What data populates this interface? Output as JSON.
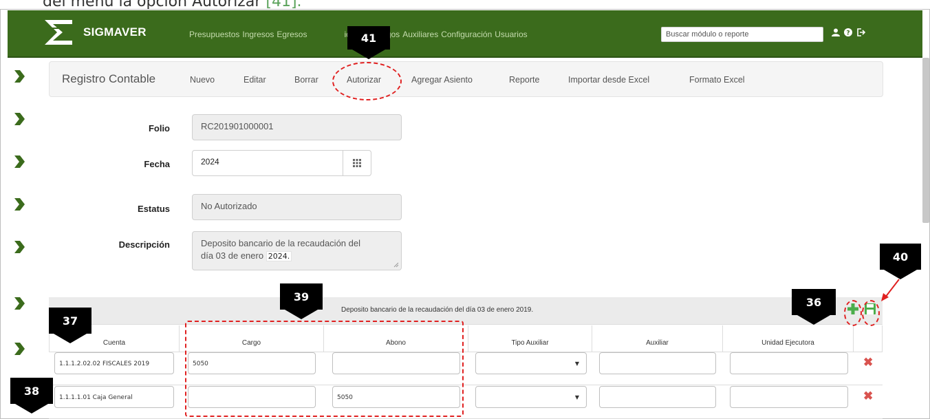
{
  "doc_caption": {
    "text": "del menú la opción Autorizar",
    "ref": "[41]."
  },
  "app": {
    "brand": "SIGMAVER"
  },
  "nav": {
    "items": [
      "Presupuestos",
      "Ingresos",
      "Egresos",
      "idad",
      "Catálogos",
      "Auxiliares",
      "Configuración",
      "Usuarios"
    ],
    "search_placeholder": "Buscar módulo o reporte",
    "icons": [
      "user-icon",
      "help-icon",
      "logout-icon"
    ]
  },
  "toolbar": {
    "title": "Registro Contable",
    "items": [
      "Nuevo",
      "Editar",
      "Borrar",
      "Autorizar",
      "Agregar Asiento",
      "Reporte",
      "Importar desde Excel",
      "Formato Excel"
    ]
  },
  "form": {
    "folio_label": "Folio",
    "folio_value": "RC201901000001",
    "fecha_label": "Fecha",
    "fecha_value": "2024",
    "estatus_label": "Estatus",
    "estatus_value": "No Autorizado",
    "descripcion_label": "Descripción",
    "descripcion_line1": "Deposito bancario de la recaudación del",
    "descripcion_line2": "día 03 de enero",
    "descripcion_year": "2024."
  },
  "table": {
    "title": "Deposito bancario de la recaudación del día 03 de enero 2019.",
    "columns": [
      "Cuenta",
      "Cargo",
      "Abono",
      "Tipo Auxiliar",
      "Auxiliar",
      "Unidad Ejecutora"
    ],
    "rows": [
      {
        "cuenta": "1.1.1.2.02.02 FISCALES 2019",
        "cargo": "5050",
        "abono": ""
      },
      {
        "cuenta": "1.1.1.1.01 Caja General",
        "cargo": "",
        "abono": "5050"
      }
    ]
  },
  "callouts": {
    "c41": "41",
    "c40": "40",
    "c39": "39",
    "c36": "36",
    "c37": "37",
    "c38": "38"
  },
  "colors": {
    "navbar": "#3b6b1c",
    "annotation": "#e02020",
    "delete": "#d9534f",
    "add": "#4cae4c"
  }
}
